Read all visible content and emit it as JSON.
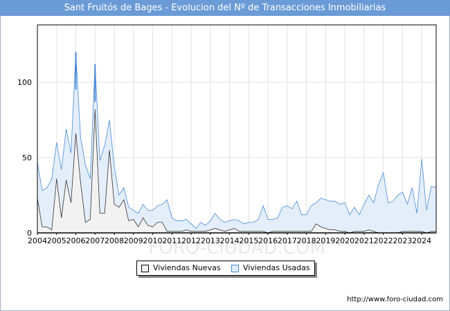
{
  "header": {
    "title": "Sant Fruitós de Bages - Evolucion del Nº de Transacciones Inmobiliarias"
  },
  "legend": {
    "nuevas": "Viviendas Nuevas",
    "usadas": "Viviendas Usadas"
  },
  "footer": {
    "url": "http://www.foro-ciudad.com"
  },
  "watermark": "FORO-CIUDAD.COM",
  "colors": {
    "nuevas_fill": "#f2f2f2",
    "nuevas_line": "#333333",
    "usadas_fill": "#e3eefa",
    "usadas_line": "#4a8ad6",
    "title_bg": "#6b9bd6"
  },
  "chart_data": {
    "type": "area",
    "title": "Sant Fruitós de Bages - Evolucion del Nº de Transacciones Inmobiliarias",
    "xlabel": "",
    "ylabel": "",
    "xlim": [
      2004,
      2024.75
    ],
    "ylim": [
      0,
      138
    ],
    "yticks": [
      0,
      50,
      100
    ],
    "xticks": [
      "2004",
      "2005",
      "2006",
      "2007",
      "2008",
      "2009",
      "2010",
      "2011",
      "2012",
      "2013",
      "2014",
      "2015",
      "2016",
      "2017",
      "2018",
      "2019",
      "2020",
      "2021",
      "2022",
      "2023",
      "2024"
    ],
    "grid": true,
    "legend_position": "bottom",
    "x": [
      2004,
      2004.25,
      2004.5,
      2004.75,
      2005,
      2005.25,
      2005.5,
      2005.75,
      2006,
      2006.25,
      2006.5,
      2006.75,
      2007,
      2007.25,
      2007.5,
      2007.75,
      2008,
      2008.25,
      2008.5,
      2008.75,
      2009,
      2009.25,
      2009.5,
      2009.75,
      2010,
      2010.25,
      2010.5,
      2010.75,
      2011,
      2011.25,
      2011.5,
      2011.75,
      2012,
      2012.25,
      2012.5,
      2012.75,
      2013,
      2013.25,
      2013.5,
      2013.75,
      2014,
      2014.25,
      2014.5,
      2014.75,
      2015,
      2015.25,
      2015.5,
      2015.75,
      2016,
      2016.25,
      2016.5,
      2016.75,
      2017,
      2017.25,
      2017.5,
      2017.75,
      2018,
      2018.25,
      2018.5,
      2018.75,
      2019,
      2019.25,
      2019.5,
      2019.75,
      2020,
      2020.25,
      2020.5,
      2020.75,
      2021,
      2021.25,
      2021.5,
      2021.75,
      2022,
      2022.25,
      2022.5,
      2022.75,
      2023,
      2023.25,
      2023.5,
      2023.75,
      2024,
      2024.25,
      2024.5,
      2024.75
    ],
    "series": [
      {
        "name": "Viviendas Nuevas",
        "values": [
          23,
          4,
          4,
          2,
          36,
          10,
          35,
          20,
          66,
          33,
          7,
          9,
          82,
          13,
          13,
          55,
          19,
          17,
          22,
          8,
          9,
          4,
          10,
          5,
          4,
          7,
          7,
          1,
          1,
          1,
          1,
          2,
          1,
          1,
          1,
          1,
          2,
          3,
          2,
          1,
          2,
          3,
          1,
          1,
          1,
          1,
          1,
          1,
          0,
          1,
          1,
          1,
          1,
          1,
          1,
          1,
          1,
          1,
          6,
          4,
          3,
          2,
          2,
          1,
          1,
          0,
          1,
          1,
          1,
          2,
          1,
          0,
          0,
          0,
          0,
          0,
          1,
          1,
          1,
          1,
          1,
          0,
          1,
          1
        ]
      },
      {
        "name": "Viviendas Usadas",
        "values": [
          24,
          24,
          26,
          34,
          24,
          32,
          34,
          33,
          54,
          30,
          38,
          27,
          30,
          35,
          45,
          20,
          25,
          8,
          8,
          9,
          6,
          9,
          9,
          10,
          11,
          11,
          12,
          21,
          9,
          7,
          7,
          7,
          5,
          2,
          6,
          4,
          6,
          10,
          7,
          6,
          6,
          6,
          7,
          5,
          6,
          6,
          8,
          17,
          9,
          8,
          9,
          16,
          17,
          15,
          20,
          11,
          11,
          17,
          14,
          19,
          19,
          19,
          19,
          18,
          19,
          12,
          16,
          11,
          18,
          23,
          19,
          32,
          40,
          20,
          21,
          25,
          26,
          18,
          29,
          12,
          48,
          15,
          30,
          29
        ]
      }
    ]
  }
}
